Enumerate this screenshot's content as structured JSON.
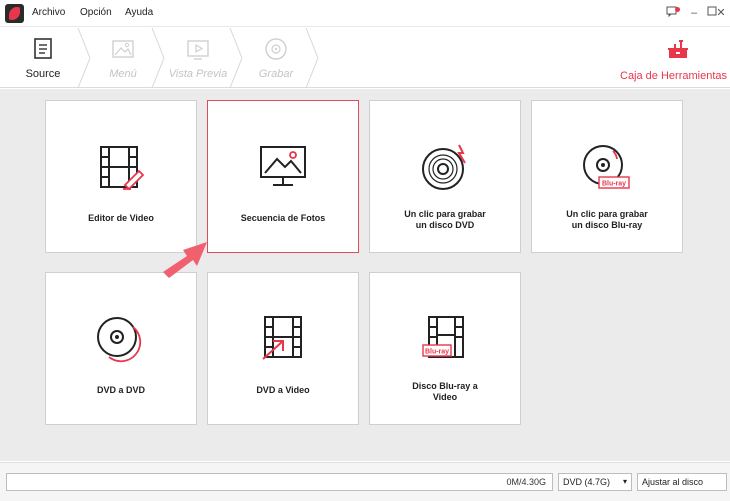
{
  "menu": {
    "items": [
      "Archivo",
      "Opción",
      "Ayuda"
    ]
  },
  "window_controls": [
    "notification-icon",
    "minimize-icon",
    "restore-icon",
    "close-icon"
  ],
  "steps": [
    {
      "label": "Source",
      "icon": "source-icon",
      "active": true
    },
    {
      "label": "Menú",
      "icon": "menu-image-icon",
      "active": false
    },
    {
      "label": "Vista Previa",
      "icon": "preview-icon",
      "active": false
    },
    {
      "label": "Grabar",
      "icon": "burn-icon",
      "active": false
    }
  ],
  "toolbox": {
    "label": "Caja de Herramientas",
    "icon": "toolbox-icon"
  },
  "cards": [
    {
      "label_lines": [
        "Editor de Video"
      ],
      "icon": "video-editor-icon",
      "selected": false
    },
    {
      "label_lines": [
        "Secuencia de Fotos"
      ],
      "icon": "photo-slideshow-icon",
      "selected": true
    },
    {
      "label_lines": [
        "Un clic para grabar",
        "un disco DVD"
      ],
      "icon": "burn-dvd-icon",
      "selected": false
    },
    {
      "label_lines": [
        "Un clic para grabar",
        "un disco Blu-ray"
      ],
      "icon": "burn-bluray-icon",
      "selected": false,
      "badge": "Blu-ray"
    },
    {
      "label_lines": [
        "DVD a DVD"
      ],
      "icon": "dvd-to-dvd-icon",
      "selected": false
    },
    {
      "label_lines": [
        "DVD a Video"
      ],
      "icon": "dvd-to-video-icon",
      "selected": false
    },
    {
      "label_lines": [
        "Disco Blu-ray a",
        "Video"
      ],
      "icon": "bluray-to-video-icon",
      "selected": false,
      "badge": "Blu-ray"
    }
  ],
  "status": {
    "capacity_text": "0M/4.30G",
    "disc_type": "DVD (4.7G)",
    "fit_option": "Ajustar al disco"
  },
  "colors": {
    "accent": "#e8364b",
    "selected_border": "#e04b5a",
    "arrow": "#f0606e",
    "background": "#ebebeb"
  }
}
